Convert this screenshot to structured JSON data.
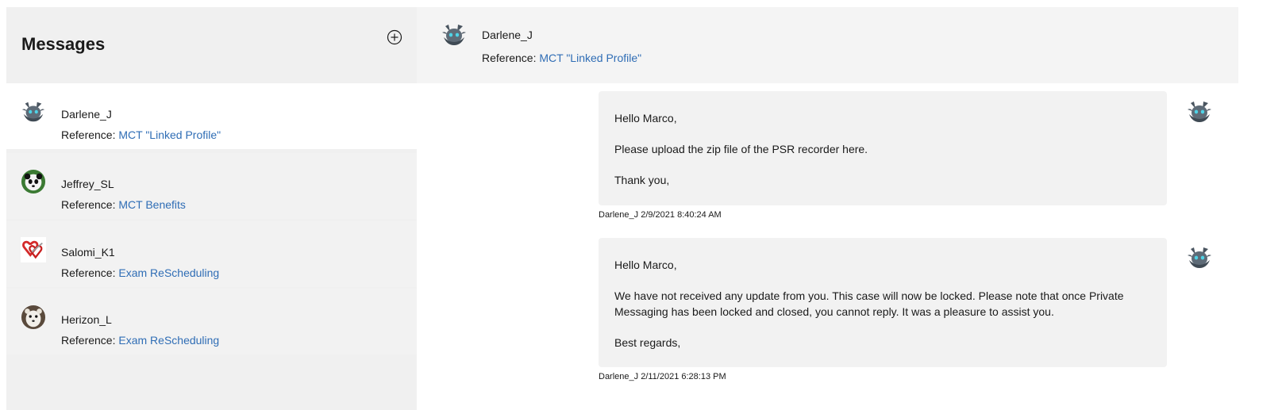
{
  "sidebar": {
    "title": "Messages",
    "new_message_icon": "plus-circle-icon",
    "conversations": [
      {
        "name": "Darlene_J",
        "ref_label": "Reference:",
        "ref_link": "MCT \"Linked Profile\"",
        "avatar": "wolf-avatar",
        "active": true
      },
      {
        "name": "Jeffrey_SL",
        "ref_label": "Reference:",
        "ref_link": "MCT Benefits",
        "avatar": "panda-avatar",
        "active": false
      },
      {
        "name": "Salomi_K1",
        "ref_label": "Reference:",
        "ref_link": "Exam ReScheduling",
        "avatar": "hearts-avatar",
        "active": false
      },
      {
        "name": "Herizon_L",
        "ref_label": "Reference:",
        "ref_link": "Exam ReScheduling",
        "avatar": "ferret-avatar",
        "active": false
      }
    ]
  },
  "thread_header": {
    "name": "Darlene_J",
    "ref_label": "Reference:",
    "ref_link": "MCT \"Linked Profile\""
  },
  "messages": [
    {
      "paragraphs": [
        "Hello Marco,",
        "Please upload the zip file of the PSR recorder here.",
        "Thank you,"
      ],
      "meta": "Darlene_J 2/9/2021 8:40:24 AM"
    },
    {
      "paragraphs": [
        "Hello Marco,",
        "We have not received any update from you. This case will now be locked. Please note that once Private Messaging has been locked and closed, you cannot reply. It was a pleasure to assist you.",
        "Best regards,"
      ],
      "meta": "Darlene_J 2/11/2021 6:28:13 PM"
    }
  ],
  "colors": {
    "link": "#2f6db5",
    "panel": "#f0f0f0",
    "bubble": "#f2f2f2"
  }
}
